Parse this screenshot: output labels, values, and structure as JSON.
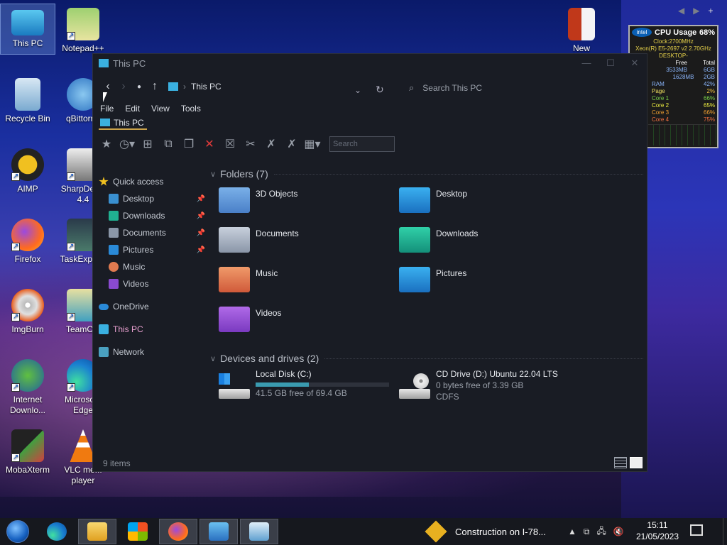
{
  "desktop": {
    "icons": [
      {
        "label": "This PC"
      },
      {
        "label": "Notepad++"
      },
      {
        "label": "Recycle Bin"
      },
      {
        "label": "qBittorr..."
      },
      {
        "label": "AIMP"
      },
      {
        "label": "SharpDev... 4.4"
      },
      {
        "label": "Firefox"
      },
      {
        "label": "TaskExplo..."
      },
      {
        "label": "ImgBurn"
      },
      {
        "label": "TeamC..."
      },
      {
        "label": "Internet Downlo..."
      },
      {
        "label": "Microso... Edge"
      },
      {
        "label": "MobaXterm"
      },
      {
        "label": "VLC me... player"
      },
      {
        "label": "New"
      }
    ]
  },
  "cpu_gadget": {
    "title": "CPU Usage",
    "percent": "68%",
    "clock": "Clock:2700MHz",
    "model": "Xeon(R) E5-2697 v2 2.70GHz",
    "host": "DESKTOP-",
    "headers": [
      "d",
      "Free",
      "Total"
    ],
    "rows": [
      {
        "label": "MB",
        "free": "3533MB",
        "total": "6GB"
      },
      {
        "label": "",
        "free": "1628MB",
        "total": "2GB"
      },
      {
        "label": "RAM",
        "free": "",
        "total": "42%"
      },
      {
        "label": "Page",
        "free": "",
        "total": "2%"
      },
      {
        "label": "Core 1",
        "free": "",
        "total": "66%"
      },
      {
        "label": "Core 2",
        "free": "",
        "total": "65%"
      },
      {
        "label": "Core 3",
        "free": "",
        "total": "66%"
      },
      {
        "label": "Core 4",
        "free": "",
        "total": "75%"
      }
    ],
    "bar_levels": [
      0.66,
      0.65,
      0.66,
      0.75
    ]
  },
  "window": {
    "title": "This PC",
    "breadcrumb": "This PC",
    "search_placeholder": "Search This PC",
    "menu": [
      "File",
      "Edit",
      "View",
      "Tools"
    ],
    "tab": "This PC",
    "toolbar_search": "Search",
    "nav": [
      {
        "label": "Quick access",
        "icon": "star-icon"
      },
      {
        "label": "Desktop",
        "icon": "desktop-icon"
      },
      {
        "label": "Downloads",
        "icon": "downloads-icon"
      },
      {
        "label": "Documents",
        "icon": "documents-icon"
      },
      {
        "label": "Pictures",
        "icon": "pictures-icon"
      },
      {
        "label": "Music",
        "icon": "music-icon"
      },
      {
        "label": "Videos",
        "icon": "videos-icon"
      },
      {
        "label": "OneDrive",
        "icon": "cloud-icon"
      },
      {
        "label": "This PC",
        "icon": "computer-icon"
      },
      {
        "label": "Network",
        "icon": "network-icon"
      }
    ],
    "folders_header": "Folders (7)",
    "folders": [
      "3D Objects",
      "Desktop",
      "Documents",
      "Downloads",
      "Music",
      "Pictures",
      "Videos"
    ],
    "drives_header": "Devices and drives (2)",
    "drives": [
      {
        "name": "Local Disk (C:)",
        "detail": "41.5 GB free of 69.4 GB",
        "used_fraction": 0.4
      },
      {
        "name": "CD Drive (D:) Ubuntu 22.04 LTS",
        "detail": "0 bytes free of 3.39 GB",
        "fs": "CDFS"
      }
    ],
    "status": "9 items"
  },
  "taskbar": {
    "notification": "Construction on I-78...",
    "time": "15:11",
    "date": "21/05/2023"
  },
  "colors": {
    "accent": "#caa24a",
    "drive_bar": "#3a9bb0",
    "window_bg": "#191c24"
  }
}
